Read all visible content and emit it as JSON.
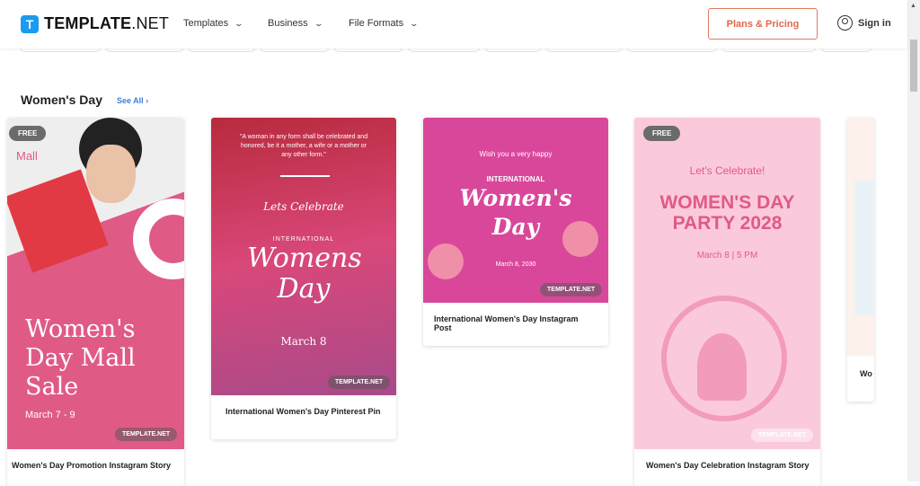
{
  "header": {
    "logo_mark": "T",
    "logo_bold": "TEMPLATE",
    "logo_light": ".NET",
    "nav": [
      {
        "label": "Templates"
      },
      {
        "label": "Business"
      },
      {
        "label": "File Formats"
      }
    ],
    "plans_label": "Plans & Pricing",
    "signin_label": "Sign in"
  },
  "section": {
    "title": "Women's Day",
    "see_all": "See All"
  },
  "cards": [
    {
      "caption": "Women's Day Promotion Instagram Story",
      "badge": "FREE",
      "watermark": "TEMPLATE.NET",
      "brand": "Mall",
      "title": "Women's Day Mall Sale",
      "date": "March 7 - 9"
    },
    {
      "caption": "International Women's Day Pinterest Pin",
      "watermark": "TEMPLATE.NET",
      "quote": "\"A woman in any form shall be celebrated and honored, be it a mother, a wife or a mother or any other form.\"",
      "sub": "Lets Celebrate",
      "kicker": "INTERNATIONAL",
      "title": "Womens Day",
      "date": "March 8"
    },
    {
      "caption": "International Women's Day Instagram Post",
      "watermark": "TEMPLATE.NET",
      "sub": "Wish you a very happy",
      "kicker": "INTERNATIONAL",
      "title": "Women's Day",
      "date": "March 8, 2030"
    },
    {
      "caption": "Women's Day Celebration Instagram Story",
      "badge": "FREE",
      "watermark": "TEMPLATE.NET",
      "sub": "Let's Celebrate!",
      "title": "WOMEN'S DAY PARTY 2028",
      "date": "March 8 | 5 PM"
    },
    {
      "caption": "Wo"
    }
  ],
  "colors": {
    "accent": "#e0694b",
    "link": "#3d7fd9",
    "pink": "#e05a86",
    "magenta": "#d9479b",
    "light_pink": "#fbc9dc"
  }
}
